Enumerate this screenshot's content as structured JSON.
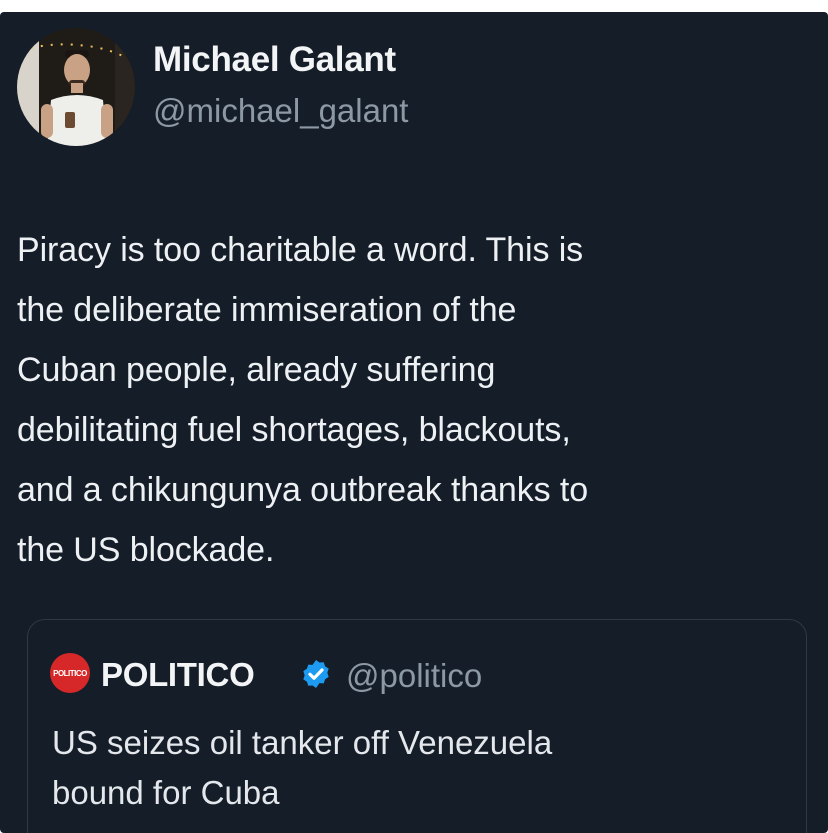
{
  "author": {
    "display_name": "Michael Galant",
    "handle": "@michael_galant"
  },
  "tweet": {
    "lines": [
      "Piracy is too charitable a word. This is",
      "the deliberate immiseration of the",
      "Cuban people, already suffering",
      "debilitating fuel shortages, blackouts,",
      "and a chikungunya outbreak thanks to",
      "the US blockade."
    ]
  },
  "quoted": {
    "logo_text": "POLITICO",
    "display_name": "POLITICO",
    "verified_icon": "verified-badge-icon",
    "handle": "@politico",
    "lines": [
      "US seizes oil tanker off Venezuela",
      "bound for Cuba"
    ]
  },
  "colors": {
    "background": "#151d28",
    "primary_text": "#eef1f4",
    "secondary_text": "#8d98a5",
    "verified_blue": "#1d9bf0",
    "politico_red": "#d62828"
  }
}
